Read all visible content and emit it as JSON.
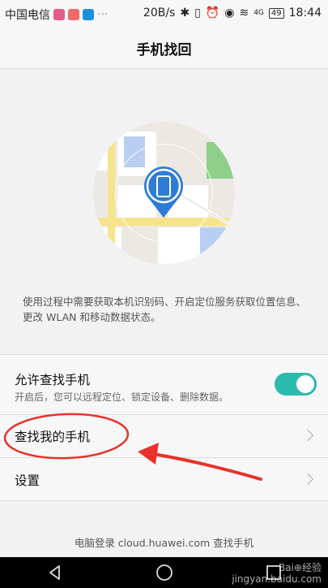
{
  "status_bar": {
    "carrier": "中国电信",
    "speed": "20B/s",
    "network": "4G",
    "battery": "49",
    "time": "18:44"
  },
  "header": {
    "title": "手机找回"
  },
  "description": "使用过程中需要获取本机识别码、开启定位服务获取位置信息、更改 WLAN 和移动数据状态。",
  "settings": {
    "allow_find": {
      "title": "允许查找手机",
      "subtitle": "开启后，您可以远程定位、锁定设备、删除数据。",
      "enabled": true
    },
    "find_my_phone": {
      "title": "查找我的手机"
    },
    "settings_item": {
      "title": "设置"
    }
  },
  "footer": {
    "text": "电脑登录 cloud.huawei.com 查找手机"
  },
  "colors": {
    "toggle_on": "#2bbbad",
    "annotation_red": "#e8322b",
    "pin_blue": "#2e7cd6"
  }
}
